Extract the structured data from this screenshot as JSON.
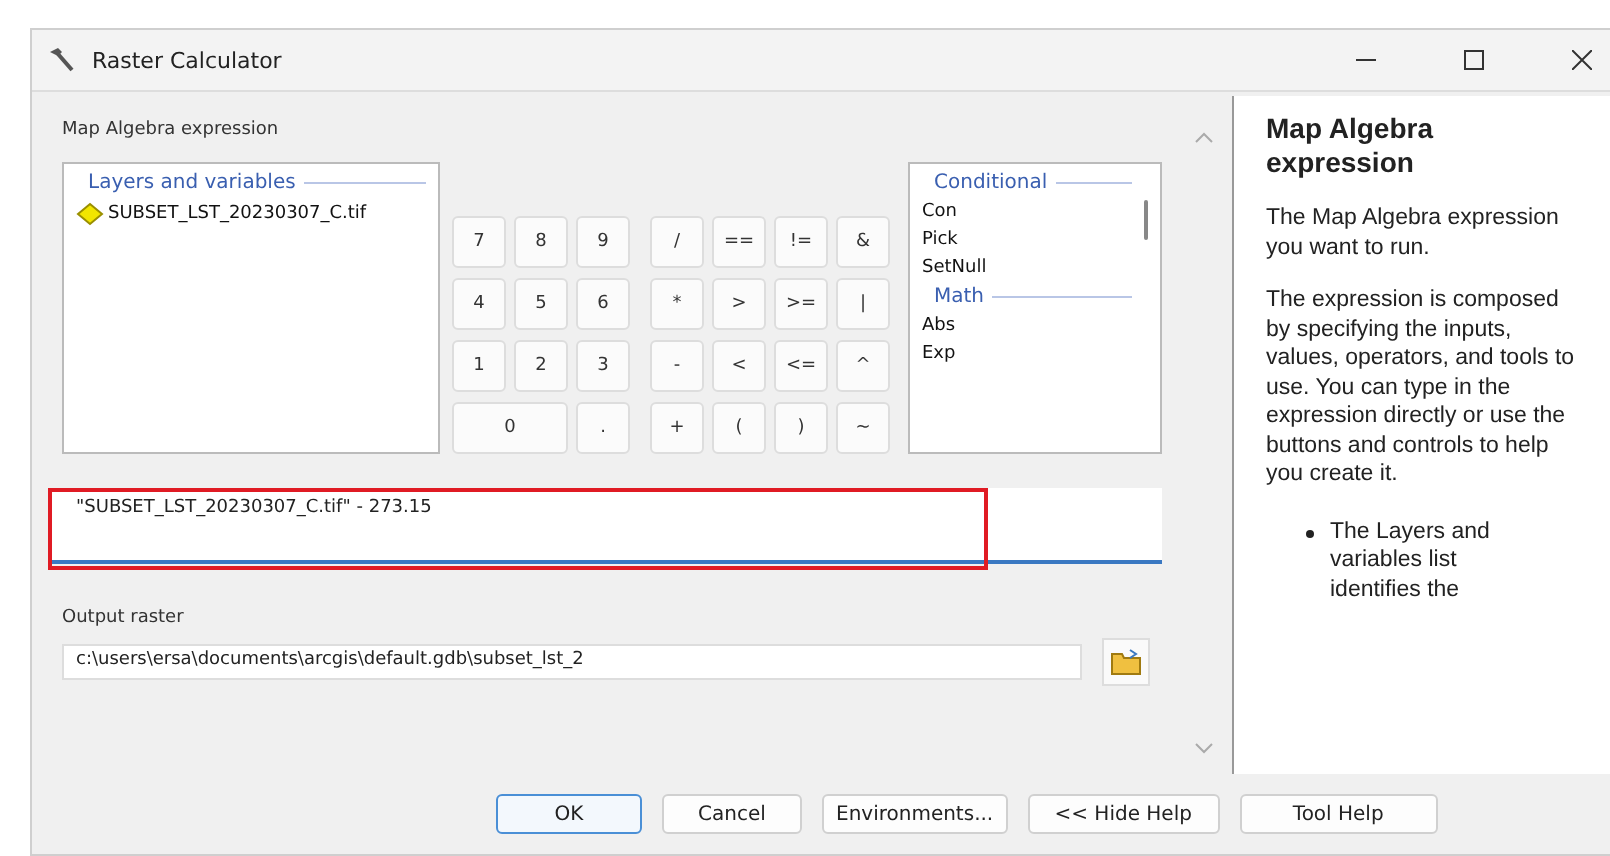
{
  "window": {
    "title": "Raster Calculator"
  },
  "expression_label": "Map Algebra expression",
  "layers": {
    "heading": "Layers and variables",
    "items": [
      {
        "name": "SUBSET_LST_20230307_C.tif",
        "selected": false
      }
    ]
  },
  "number_keys": [
    {
      "label": "7",
      "kind": "normal"
    },
    {
      "label": "8",
      "kind": "normal"
    },
    {
      "label": "9",
      "kind": "normal"
    },
    {
      "label": "4",
      "kind": "normal"
    },
    {
      "label": "5",
      "kind": "normal"
    },
    {
      "label": "6",
      "kind": "normal"
    },
    {
      "label": "1",
      "kind": "normal"
    },
    {
      "label": "2",
      "kind": "normal"
    },
    {
      "label": "3",
      "kind": "normal"
    },
    {
      "label": "0",
      "kind": "wide"
    },
    {
      "label": ".",
      "kind": "normal"
    }
  ],
  "operator_keys": [
    "/",
    "==",
    "!=",
    "&",
    "*",
    ">",
    ">=",
    "|",
    "-",
    "<",
    "<=",
    "^",
    "+",
    "(",
    ")",
    "~"
  ],
  "functions": [
    {
      "heading": "Conditional",
      "items": [
        "Con",
        "Pick",
        "SetNull"
      ]
    },
    {
      "heading": "Math",
      "items": [
        "Abs",
        "Exp"
      ]
    }
  ],
  "expression": {
    "value": "\"SUBSET_LST_20230307_C.tif\" - 273.15",
    "highlighted": true
  },
  "output": {
    "label": "Output raster",
    "value": "c:\\users\\ersa\\documents\\arcgis\\default.gdb\\subset_lst_2"
  },
  "help": {
    "title": "Map Algebra expression",
    "paragraphs": [
      "The Map Algebra expression you want to run.",
      "The expression is composed by specifying the inputs, values, operators, and tools to use. You can type in the expression directly or use the buttons and controls to help you create it."
    ],
    "bullets": [
      "The Layers and variables list identifies the"
    ]
  },
  "buttons": [
    {
      "label": "OK",
      "default": true
    },
    {
      "label": "Cancel",
      "default": false
    },
    {
      "label": "Environments...",
      "default": false
    },
    {
      "label": "<< Hide Help",
      "default": false
    },
    {
      "label": "Tool Help",
      "default": false
    }
  ]
}
